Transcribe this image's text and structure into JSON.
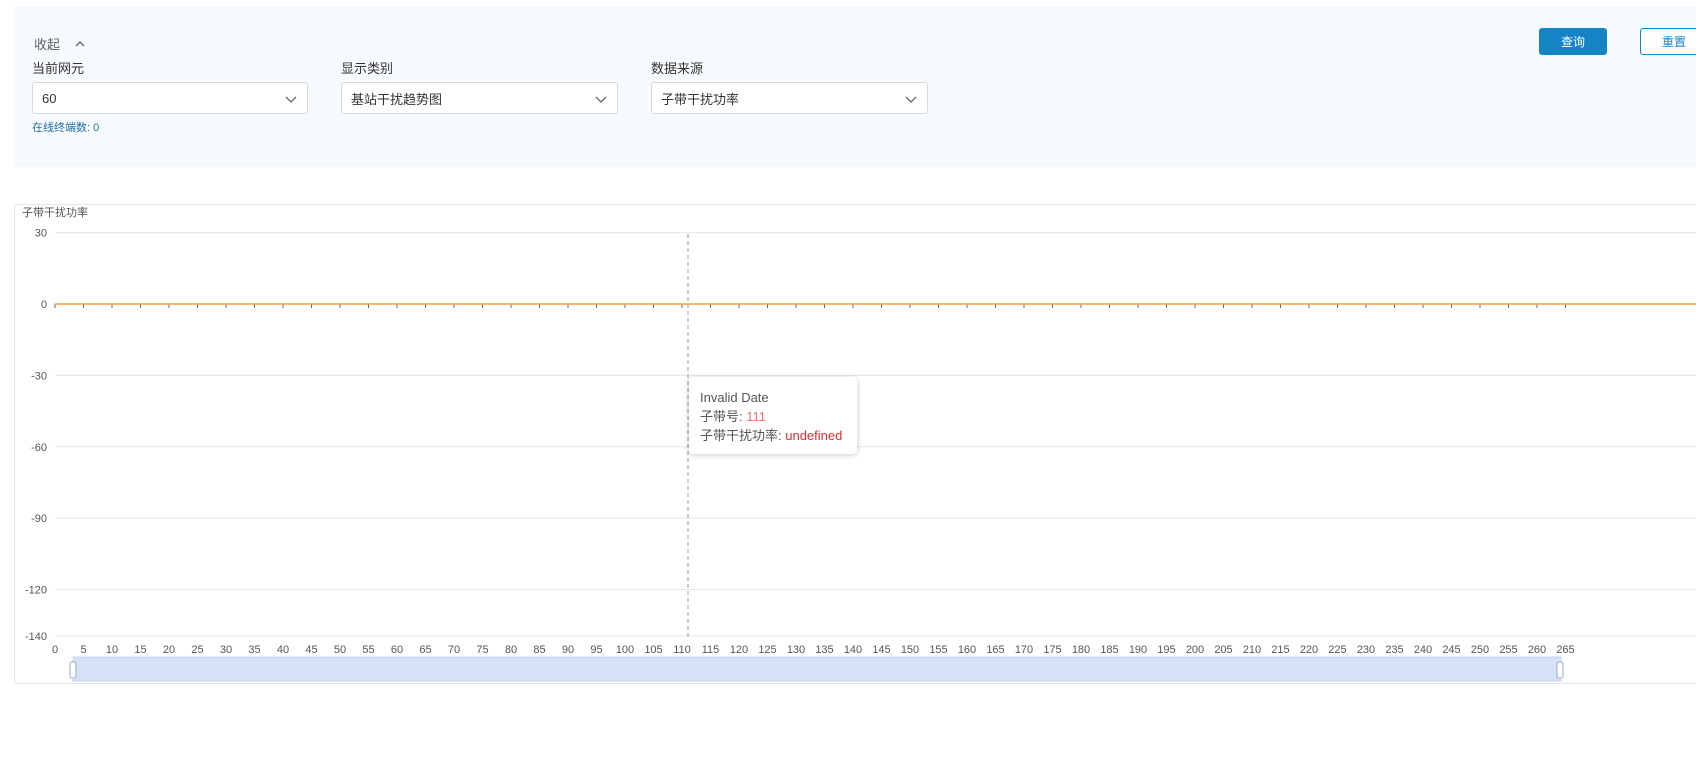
{
  "filter": {
    "collapse_label": "收起",
    "query_button": "查询",
    "reset_button": "重置",
    "fields": [
      {
        "label": "当前网元",
        "value": "60"
      },
      {
        "label": "显示类别",
        "value": "基站干扰趋势图"
      },
      {
        "label": "数据来源",
        "value": "子带干扰功率"
      }
    ],
    "online_count_label": "在线终端数: 0"
  },
  "tooltip": {
    "title": "Invalid Date",
    "row1_label": "子带号: ",
    "row1_value": "111",
    "row2_label": "子带干扰功率: ",
    "row2_value": "undefined"
  },
  "colors": {
    "accent": "#1584c4",
    "series_line": "#f5a23c",
    "slider_fill": "#d5e1f7"
  },
  "chart_data": {
    "type": "line",
    "ylabel": "子带干扰功率",
    "y_ticks": [
      30,
      0,
      -30,
      -60,
      -90,
      -120,
      -140
    ],
    "ylim": [
      -140,
      30
    ],
    "x_ticks": [
      0,
      5,
      10,
      15,
      20,
      25,
      30,
      35,
      40,
      45,
      50,
      55,
      60,
      65,
      70,
      75,
      80,
      85,
      90,
      95,
      100,
      105,
      110,
      115,
      120,
      125,
      130,
      135,
      140,
      145,
      150,
      155,
      160,
      165,
      170,
      175,
      180,
      185,
      190,
      195,
      200,
      205,
      210,
      215,
      220,
      225,
      230,
      235,
      240,
      245,
      250,
      255,
      260,
      265
    ],
    "series": [
      {
        "values_constant": 0,
        "x_range": [
          0,
          265
        ]
      }
    ],
    "pointer_x": 111,
    "grid": true,
    "data_zoom": true
  }
}
